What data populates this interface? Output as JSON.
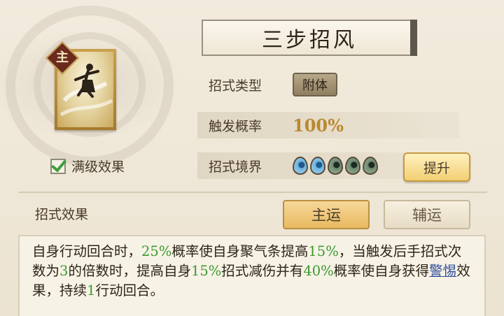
{
  "skill": {
    "name": "三步招风",
    "role_badge": "主",
    "icon": "dancer-skill-icon",
    "full_effect_label": "满级效果",
    "full_effect_checked": true
  },
  "info": {
    "type_label": "招式类型",
    "type_value": "附体",
    "rate_label": "触发概率",
    "rate_value": "100%",
    "realm_label": "招式境界",
    "realm_level": 2,
    "realm_max": 5,
    "upgrade_label": "提升"
  },
  "effect": {
    "label": "招式效果",
    "tabs": [
      {
        "label": "主运",
        "active": true
      },
      {
        "label": "辅运",
        "active": false
      }
    ],
    "description": {
      "p1": "自身行动回合时，",
      "v1": "25%",
      "p2": "概率使自身聚气条提高",
      "v2": "15%",
      "p3": "，当触发后手招式次数为",
      "v3": "3",
      "p4": "的倍数时，提高自身",
      "v4": "15%",
      "p5": "招式减伤并有",
      "v5": "40%",
      "p6": "概率使自身获得",
      "link": "警惕",
      "p7": "效果，持续",
      "v6": "1",
      "p8": "行动回合。"
    }
  },
  "colors": {
    "highlight": "#3a9a2f",
    "link": "#2d4f9a",
    "gold": "#b9892e"
  }
}
